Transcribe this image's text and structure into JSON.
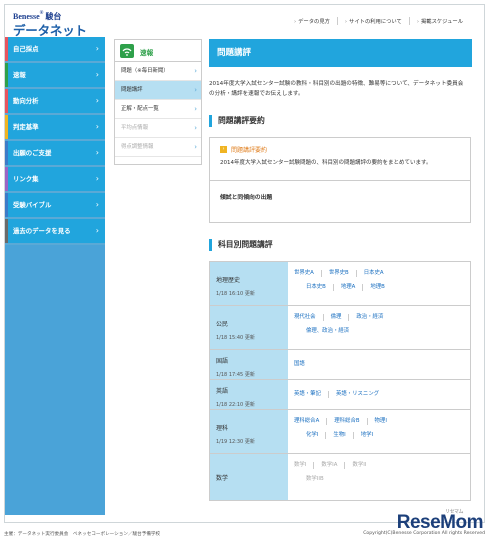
{
  "header": {
    "brand": "Benesse",
    "brand_sub": "駿台",
    "title": "データネット2014",
    "links": [
      "データの見方",
      "サイトの利用について",
      "掲載スケジュール"
    ]
  },
  "leftnav": {
    "items": [
      {
        "label": "自己採点",
        "stripe": "#e8545f"
      },
      {
        "label": "速報",
        "stripe": "#2ea04a"
      },
      {
        "label": "動向分析",
        "stripe": "#e8545f"
      },
      {
        "label": "判定基準",
        "stripe": "#f0b422"
      },
      {
        "label": "出願のご支援",
        "stripe": "#3c7bc8"
      },
      {
        "label": "リンク集",
        "stripe": "#9a63c5"
      },
      {
        "label": "受験バイブル",
        "stripe": "#3c7bc8"
      },
      {
        "label": "過去のデータを見る",
        "stripe": "#6a6a6a"
      }
    ]
  },
  "subnav": {
    "title": "速報",
    "items": [
      {
        "label": "問題（※毎日新聞）",
        "state": "normal"
      },
      {
        "label": "問題講評",
        "state": "selected"
      },
      {
        "label": "正解・配点一覧",
        "state": "normal"
      },
      {
        "label": "平均点情報",
        "state": "dim"
      },
      {
        "label": "得点調整情報",
        "state": "dim"
      }
    ]
  },
  "main": {
    "page_title": "問題講評",
    "intro": "2014年度大学入試センター試験の教科・科目別の出題の特徴、難易等について、データネット委員会の分析・講評を速報でお伝えします。",
    "summary_heading": "問題講評要約",
    "summary_link": "問題講評要約",
    "summary_text": "2014年度大学入試センター試験問題の、科目別の問題講評の要約をまとめています。",
    "summary_bold": "傾試と同傾向の出題",
    "subjects_heading": "科目別問題講評",
    "subjects": [
      {
        "name": "地理歴史",
        "date": "1/18 16:10 更新",
        "lines": [
          [
            "世界史A",
            "世界史B",
            "日本史A"
          ],
          [
            "日本史B",
            "地理A",
            "地理B"
          ]
        ],
        "dim": false
      },
      {
        "name": "公民",
        "date": "1/18 15:40 更新",
        "lines": [
          [
            "現代社会",
            "倫理",
            "政治・経済"
          ],
          [
            "倫理、政治・経済"
          ]
        ],
        "dim": false
      },
      {
        "name": "国語",
        "date": "1/18 17:45 更新",
        "lines": [
          [
            "国語"
          ]
        ],
        "dim": false
      },
      {
        "name": "英語",
        "date": "1/18 22:10 更新",
        "lines": [
          [
            "英語・筆記",
            "英語・リスニング"
          ]
        ],
        "dim": false
      },
      {
        "name": "理科",
        "date": "1/19 12:30 更新",
        "lines": [
          [
            "理科総合A",
            "理科総合B",
            "物理I"
          ],
          [
            "化学I",
            "生物I",
            "地学I"
          ]
        ],
        "dim": false
      },
      {
        "name": "数学",
        "date": "",
        "lines": [
          [
            "数学I",
            "数学IA",
            "数学II"
          ],
          [
            "数学IIB"
          ]
        ],
        "dim": true
      }
    ]
  },
  "footer": {
    "left": "主催：データネット実行委員会　ベネッセコーポレーション／駿台予備学校",
    "right": "Copyright(C)Benesse Corporation All rights Reserved"
  },
  "watermark": "ReseMom",
  "watermark_sub": "リセマム"
}
